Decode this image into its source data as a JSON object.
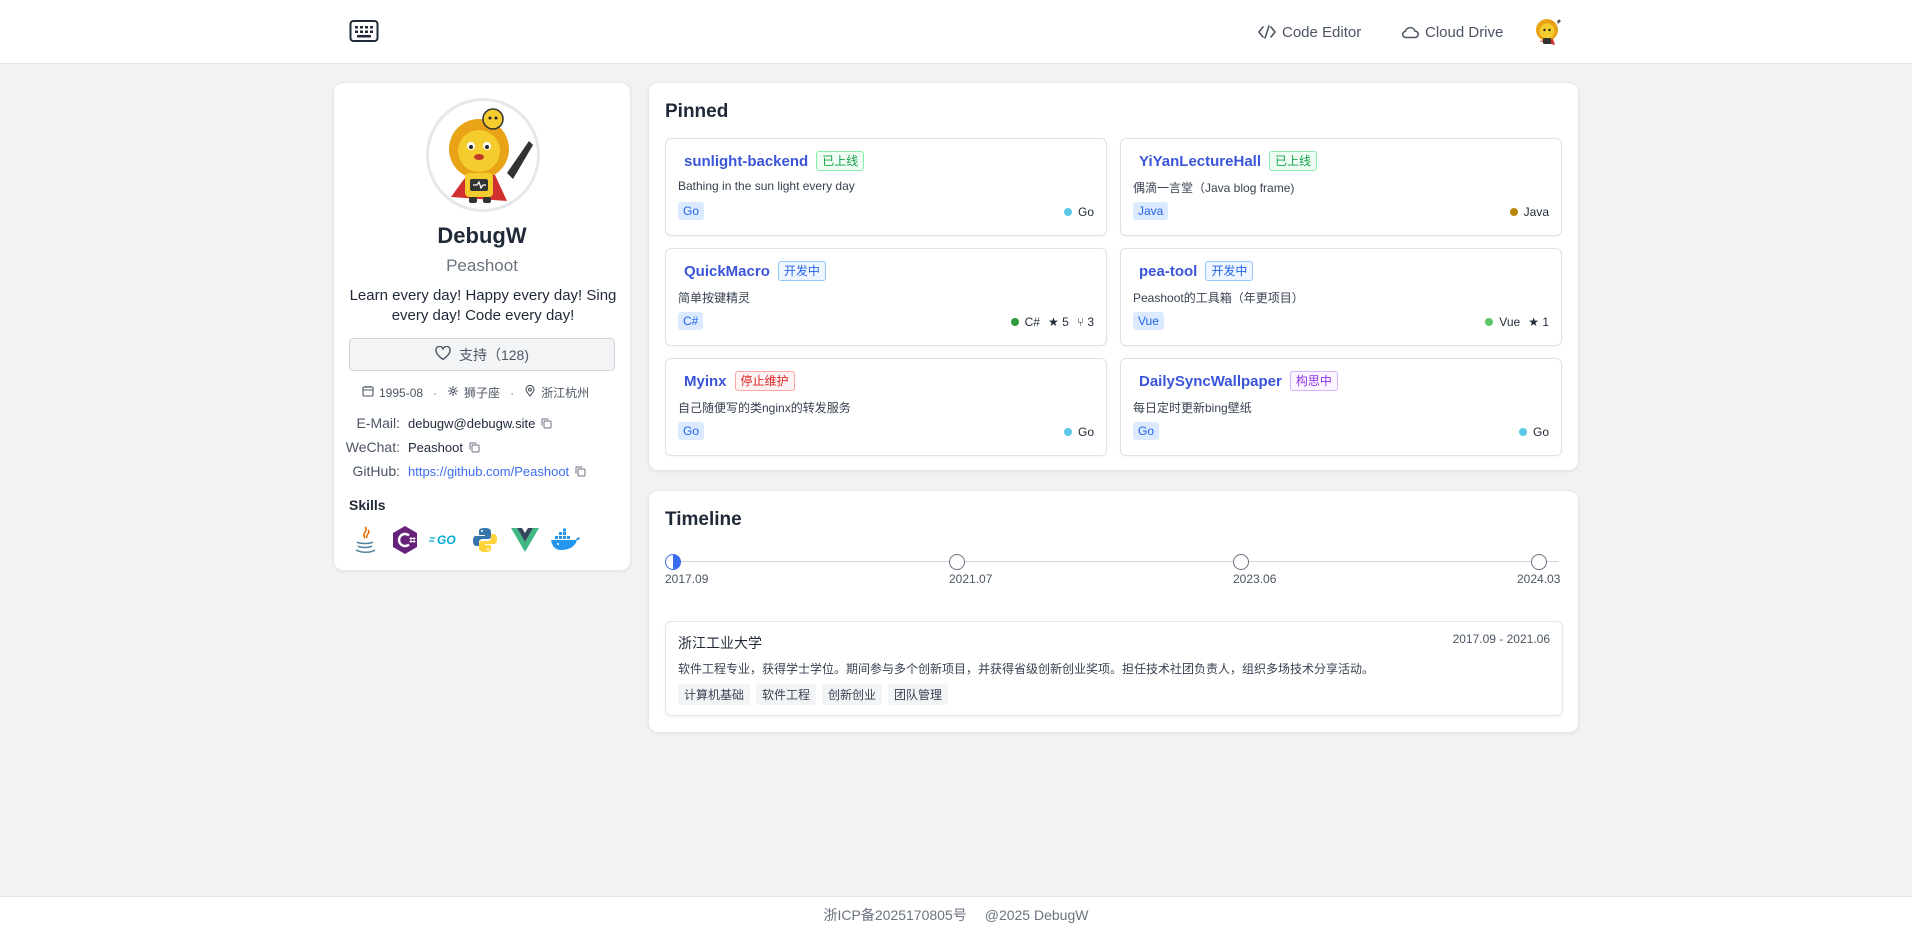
{
  "header": {
    "nav": [
      {
        "label": "Code Editor",
        "icon": "code-icon"
      },
      {
        "label": "Cloud Drive",
        "icon": "cloud-icon"
      }
    ]
  },
  "profile": {
    "name": "DebugW",
    "nickname": "Peashoot",
    "bio": "Learn every day! Happy every day! Sing every day! Code every day!",
    "support_label": "支持（128)",
    "meta": {
      "birth": "1995-08",
      "zodiac": "狮子座",
      "location": "浙江杭州"
    },
    "contacts": {
      "email_label": "E-Mail:",
      "email": "debugw@debugw.site",
      "wechat_label": "WeChat:",
      "wechat": "Peashoot",
      "github_label": "GitHub:",
      "github": "https://github.com/Peashoot"
    },
    "skills_title": "Skills",
    "skills": [
      "java-icon",
      "csharp-icon",
      "go-icon",
      "python-icon",
      "vue-icon",
      "docker-icon"
    ]
  },
  "pinned": {
    "title": "Pinned",
    "repos": [
      {
        "name": "sunlight-backend",
        "status": "已上线",
        "desc": "Bathing in the sun light every day",
        "tag": "Go",
        "lang": "Go",
        "lang_color": "#5bc8e8",
        "stars": "",
        "forks": ""
      },
      {
        "name": "YiYanLectureHall",
        "status": "已上线",
        "desc": "偶滴一言堂（Java blog frame)",
        "tag": "Java",
        "lang": "Java",
        "lang_color": "#b8860b",
        "stars": "",
        "forks": ""
      },
      {
        "name": "QuickMacro",
        "status": "开发中",
        "desc": "简单按键精灵",
        "tag": "C#",
        "lang": "C#",
        "lang_color": "#2e9a3d",
        "stars": "5",
        "forks": "3"
      },
      {
        "name": "pea-tool",
        "status": "开发中",
        "desc": "Peashoot的工具箱（年更项目）",
        "tag": "Vue",
        "lang": "Vue",
        "lang_color": "#5ec56b",
        "stars": "1",
        "forks": ""
      },
      {
        "name": "Myinx",
        "status": "停止维护",
        "desc": "自己随便写的类nginx的转发服务",
        "tag": "Go",
        "lang": "Go",
        "lang_color": "#5bc8e8",
        "stars": "",
        "forks": ""
      },
      {
        "name": "DailySyncWallpaper",
        "status": "构思中",
        "desc": "每日定时更新bing壁纸",
        "tag": "Go",
        "lang": "Go",
        "lang_color": "#5bc8e8",
        "stars": "",
        "forks": ""
      }
    ]
  },
  "timeline": {
    "title": "Timeline",
    "points": [
      "2017.09",
      "2021.07",
      "2023.06",
      "2024.03"
    ],
    "active_index": 0,
    "entry": {
      "title": "浙江工业大学",
      "date": "2017.09 - 2021.06",
      "desc": "软件工程专业，获得学士学位。期间参与多个创新项目，并获得省级创新创业奖项。担任技术社团负责人，组织多场技术分享活动。",
      "tags": [
        "计算机基础",
        "软件工程",
        "创新创业",
        "团队管理"
      ]
    }
  },
  "footer": {
    "icp": "浙ICP备2025170805号",
    "copyright": "@2025 DebugW"
  },
  "colors": {
    "accent": "#3b55d9",
    "link": "#3b6cf0",
    "background": "#f1f2f4"
  }
}
